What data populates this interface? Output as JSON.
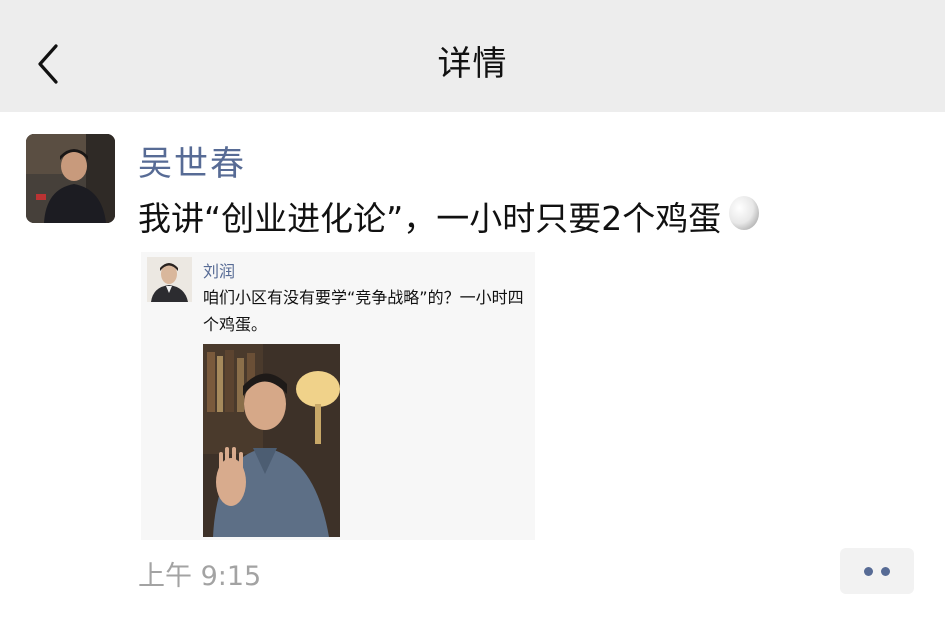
{
  "header": {
    "title": "详情",
    "back_icon": "chevron-left-icon"
  },
  "post": {
    "author": "吴世春",
    "text": "我讲“创业进化论”，一小时只要2个鸡蛋",
    "emoji_icon": "egg-icon",
    "time": "上午 9:15",
    "more_icon": "more-dots-icon"
  },
  "quoted_post": {
    "author": "刘润",
    "text": "咱们小区有没有要学“竞争战略”的？一小时四个鸡蛋。"
  },
  "colors": {
    "header_bg": "#ededed",
    "name_link": "#576b95",
    "timestamp": "#a3a3a3",
    "quote_bg": "#f7f7f7"
  }
}
